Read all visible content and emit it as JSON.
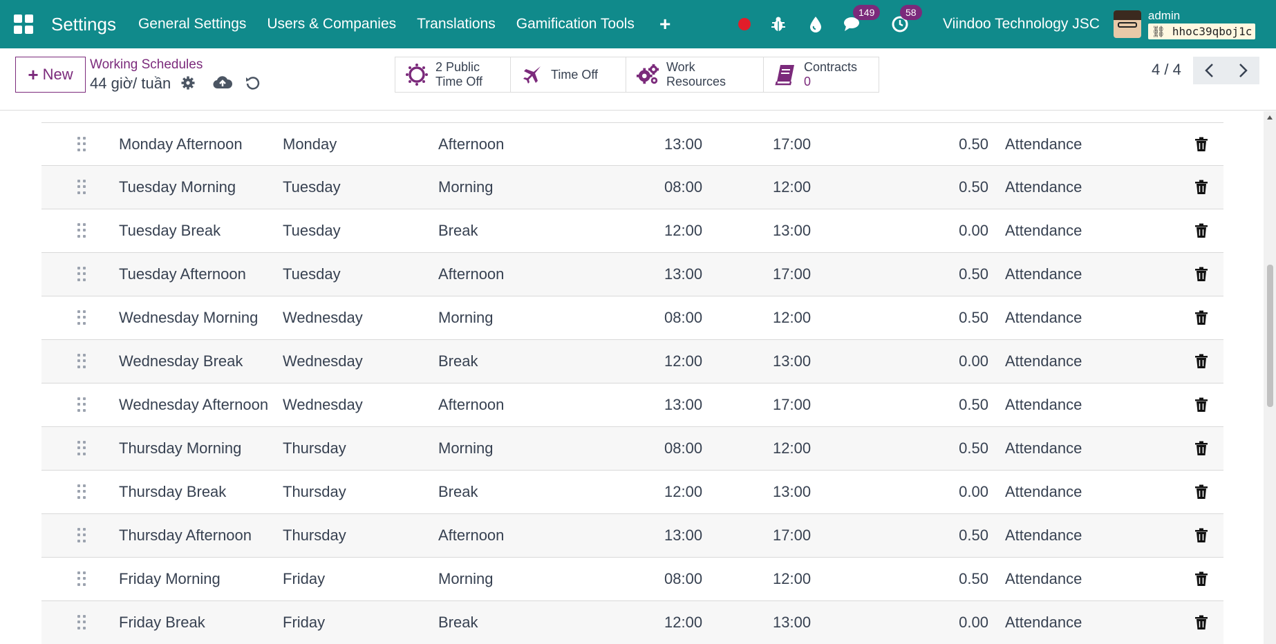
{
  "navbar": {
    "brand": "Settings",
    "menu": [
      "General Settings",
      "Users & Companies",
      "Translations",
      "Gamification Tools"
    ],
    "badges": {
      "messages": "149",
      "activities": "58"
    },
    "company": "Viindoo Technology JSC",
    "user": "admin",
    "database": "hhoc39qboj1c",
    "colors": {
      "bar": "#108a8b",
      "badge": "#7b2a7b",
      "record": "#e11d2a"
    }
  },
  "control": {
    "new_label": "New",
    "breadcrumb_parent": "Working Schedules",
    "breadcrumb_current": "44 giờ/ tuần",
    "smart_buttons": {
      "public_time_off_line1": "2 Public",
      "public_time_off_line2": "Time Off",
      "time_off": "Time Off",
      "work_resources": "Work Resources",
      "contracts_label": "Contracts",
      "contracts_count": "0"
    },
    "pager": "4 / 4"
  },
  "attendance_rows": [
    {
      "name": "Monday Afternoon",
      "day": "Monday",
      "period": "Afternoon",
      "from": "13:00",
      "to": "17:00",
      "duration": "0.50",
      "type": "Attendance"
    },
    {
      "name": "Tuesday Morning",
      "day": "Tuesday",
      "period": "Morning",
      "from": "08:00",
      "to": "12:00",
      "duration": "0.50",
      "type": "Attendance"
    },
    {
      "name": "Tuesday Break",
      "day": "Tuesday",
      "period": "Break",
      "from": "12:00",
      "to": "13:00",
      "duration": "0.00",
      "type": "Attendance"
    },
    {
      "name": "Tuesday Afternoon",
      "day": "Tuesday",
      "period": "Afternoon",
      "from": "13:00",
      "to": "17:00",
      "duration": "0.50",
      "type": "Attendance"
    },
    {
      "name": "Wednesday Morning",
      "day": "Wednesday",
      "period": "Morning",
      "from": "08:00",
      "to": "12:00",
      "duration": "0.50",
      "type": "Attendance"
    },
    {
      "name": "Wednesday Break",
      "day": "Wednesday",
      "period": "Break",
      "from": "12:00",
      "to": "13:00",
      "duration": "0.00",
      "type": "Attendance"
    },
    {
      "name": "Wednesday Afternoon",
      "day": "Wednesday",
      "period": "Afternoon",
      "from": "13:00",
      "to": "17:00",
      "duration": "0.50",
      "type": "Attendance"
    },
    {
      "name": "Thursday Morning",
      "day": "Thursday",
      "period": "Morning",
      "from": "08:00",
      "to": "12:00",
      "duration": "0.50",
      "type": "Attendance"
    },
    {
      "name": "Thursday Break",
      "day": "Thursday",
      "period": "Break",
      "from": "12:00",
      "to": "13:00",
      "duration": "0.00",
      "type": "Attendance"
    },
    {
      "name": "Thursday Afternoon",
      "day": "Thursday",
      "period": "Afternoon",
      "from": "13:00",
      "to": "17:00",
      "duration": "0.50",
      "type": "Attendance"
    },
    {
      "name": "Friday Morning",
      "day": "Friday",
      "period": "Morning",
      "from": "08:00",
      "to": "12:00",
      "duration": "0.50",
      "type": "Attendance"
    },
    {
      "name": "Friday Break",
      "day": "Friday",
      "period": "Break",
      "from": "12:00",
      "to": "13:00",
      "duration": "0.00",
      "type": "Attendance"
    }
  ],
  "icons": {
    "apps": "apps-grid-icon",
    "add": "plus-icon",
    "record": "record-dot-icon",
    "debug": "bug-icon",
    "theme": "droplet-icon",
    "messages": "chat-icon",
    "activities": "clock-icon",
    "settings": "gear-icon",
    "save": "cloud-upload-icon",
    "discard": "undo-icon",
    "drag": "drag-handle-icon",
    "delete": "trash-icon"
  }
}
